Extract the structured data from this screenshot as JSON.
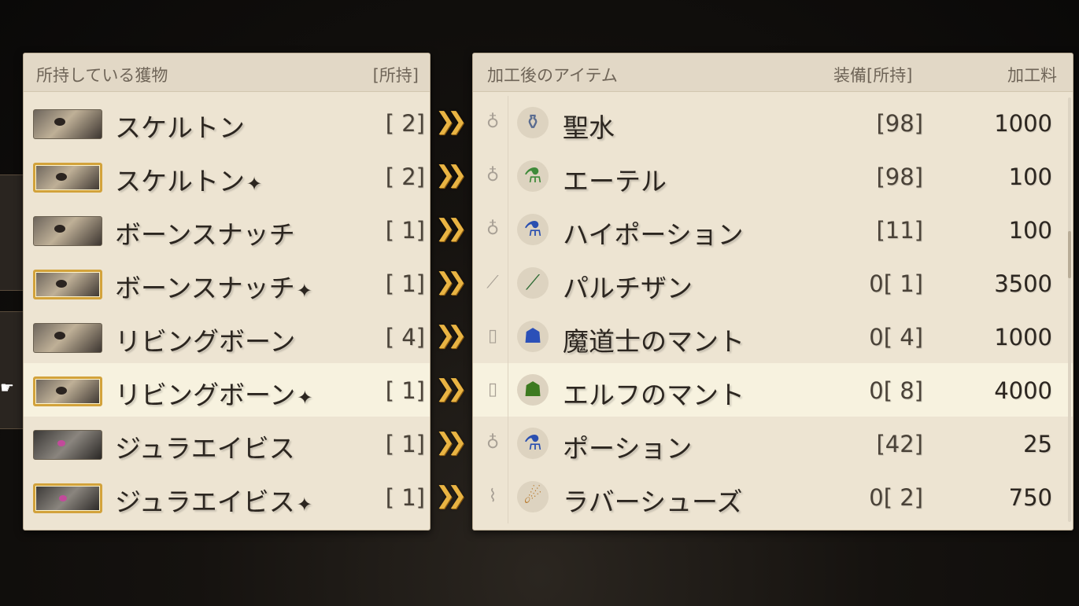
{
  "left_panel": {
    "header_title": "所持している獲物",
    "header_count": "[所持]",
    "rows": [
      {
        "name": "スケルトン",
        "rare": false,
        "bird": false,
        "count": "[ 2]"
      },
      {
        "name": "スケルトン",
        "rare": true,
        "bird": false,
        "count": "[ 2]"
      },
      {
        "name": "ボーンスナッチ",
        "rare": false,
        "bird": false,
        "count": "[ 1]"
      },
      {
        "name": "ボーンスナッチ",
        "rare": true,
        "bird": false,
        "count": "[ 1]"
      },
      {
        "name": "リビングボーン",
        "rare": false,
        "bird": false,
        "count": "[ 4]"
      },
      {
        "name": "リビングボーン",
        "rare": true,
        "bird": false,
        "count": "[ 1]"
      },
      {
        "name": "ジュラエイビス",
        "rare": false,
        "bird": true,
        "count": "[ 1]"
      },
      {
        "name": "ジュラエイビス",
        "rare": true,
        "bird": true,
        "count": "[ 1]"
      }
    ],
    "selected_index": 5
  },
  "arrow_glyph": "❯❯",
  "sparkle_glyph": "✦",
  "right_panel": {
    "header_title": "加工後のアイテム",
    "header_equip": "装備[所持]",
    "header_fee": "加工料",
    "rows": [
      {
        "type_icon": "potion-type-icon",
        "type_glyph": "♁",
        "item_icon": "holy-water-icon",
        "item_glyph": "⚱",
        "item_color": "#5a6c90",
        "name": "聖水",
        "count": "[98]",
        "fee": "1000"
      },
      {
        "type_icon": "potion-type-icon",
        "type_glyph": "♁",
        "item_icon": "ether-icon",
        "item_glyph": "⚗",
        "item_color": "#3f8a3a",
        "name": "エーテル",
        "count": "[98]",
        "fee": "100"
      },
      {
        "type_icon": "potion-type-icon",
        "type_glyph": "♁",
        "item_icon": "hi-potion-icon",
        "item_glyph": "⚗",
        "item_color": "#2a4fb0",
        "name": "ハイポーション",
        "count": "[11]",
        "fee": "100"
      },
      {
        "type_icon": "spear-type-icon",
        "type_glyph": "⟋",
        "item_icon": "partisan-icon",
        "item_glyph": "⟋",
        "item_color": "#2f6b35",
        "name": "パルチザン",
        "count": "0[ 1]",
        "fee": "3500"
      },
      {
        "type_icon": "cloak-type-icon",
        "type_glyph": "▯",
        "item_icon": "mage-cloak-icon",
        "item_glyph": "☗",
        "item_color": "#2b50b8",
        "name": "魔道士のマント",
        "count": "0[ 4]",
        "fee": "1000"
      },
      {
        "type_icon": "cloak-type-icon",
        "type_glyph": "▯",
        "item_icon": "elf-cloak-icon",
        "item_glyph": "☗",
        "item_color": "#3d7a20",
        "name": "エルフのマント",
        "count": "0[ 8]",
        "fee": "4000"
      },
      {
        "type_icon": "potion-type-icon",
        "type_glyph": "♁",
        "item_icon": "potion-icon",
        "item_glyph": "⚗",
        "item_color": "#2a4fb0",
        "name": "ポーション",
        "count": "[42]",
        "fee": "25"
      },
      {
        "type_icon": "shoes-type-icon",
        "type_glyph": "⌇",
        "item_icon": "rubber-shoes-icon",
        "item_glyph": "☄",
        "item_color": "#b7782a",
        "name": "ラバーシューズ",
        "count": "0[ 2]",
        "fee": "750"
      }
    ],
    "selected_index": 5
  }
}
